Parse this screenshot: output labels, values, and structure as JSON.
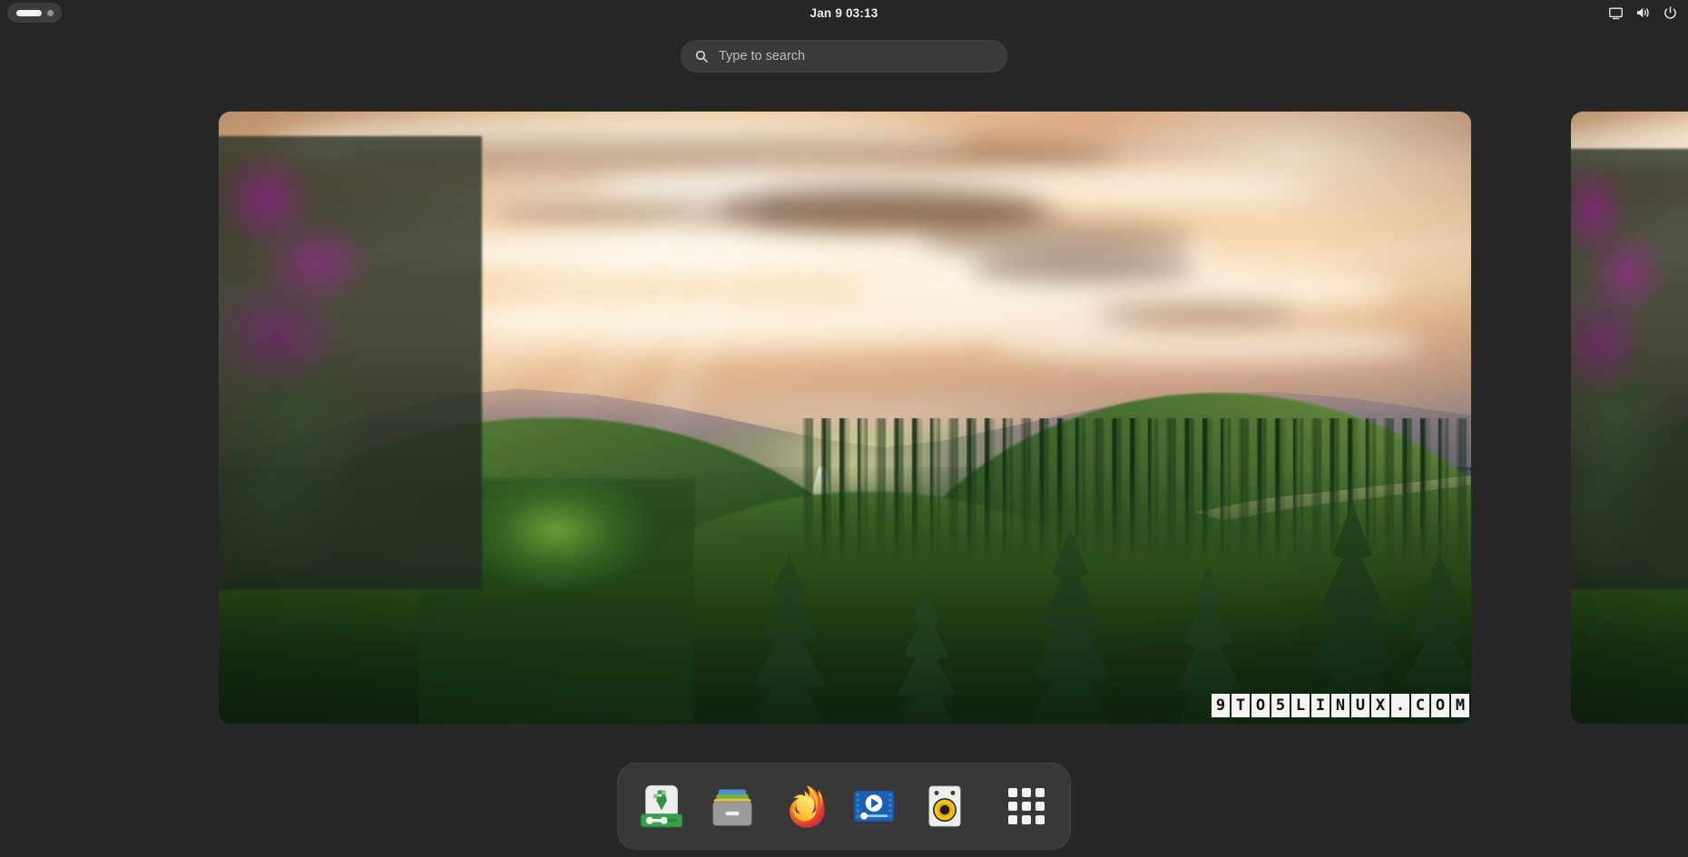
{
  "desktop": {
    "environment": "GNOME Shell Activities Overview",
    "background_color": "#272727"
  },
  "topbar": {
    "workspace_indicator": {
      "name": "workspace-switcher",
      "active_label": "",
      "dots": 2
    },
    "clock": "Jan 9  03:13",
    "tray": [
      {
        "name": "display-icon",
        "label": "Screen / display settings"
      },
      {
        "name": "volume-icon",
        "label": "Volume"
      },
      {
        "name": "power-icon",
        "label": "Power / system menu"
      }
    ]
  },
  "search": {
    "placeholder": "Type to search",
    "value": "",
    "icon": "search-icon"
  },
  "workspaces": {
    "active_index": 0,
    "thumbnails": [
      {
        "name": "workspace-1",
        "wallpaper": "mountain-valley-sunset",
        "active": true
      },
      {
        "name": "workspace-2",
        "wallpaper": "mountain-valley-sunset",
        "active": false
      }
    ],
    "wallpaper": {
      "title": "Mountain valley at sunset",
      "colors": {
        "sky_highlight": "#f7ddba",
        "sky_warm": "#d9a87e",
        "mountain": "#58607a",
        "forest_light": "#6d8c3e",
        "forest_dark": "#162d18",
        "flowers": "#8c2882"
      }
    },
    "watermark": "9TO5LINUX.COM"
  },
  "dock": {
    "items": [
      {
        "name": "dock-item-software",
        "label": "Software",
        "icon": "software-install-icon"
      },
      {
        "name": "dock-item-files",
        "label": "Files",
        "icon": "file-cabinet-icon"
      },
      {
        "name": "dock-item-firefox",
        "label": "Firefox",
        "icon": "firefox-icon"
      },
      {
        "name": "dock-item-videos",
        "label": "Videos",
        "icon": "film-play-icon"
      },
      {
        "name": "dock-item-rhythmbox",
        "label": "Rhythmbox",
        "icon": "speaker-icon"
      },
      {
        "name": "dock-item-show-apps",
        "label": "Show Applications",
        "icon": "app-grid-icon"
      }
    ]
  }
}
